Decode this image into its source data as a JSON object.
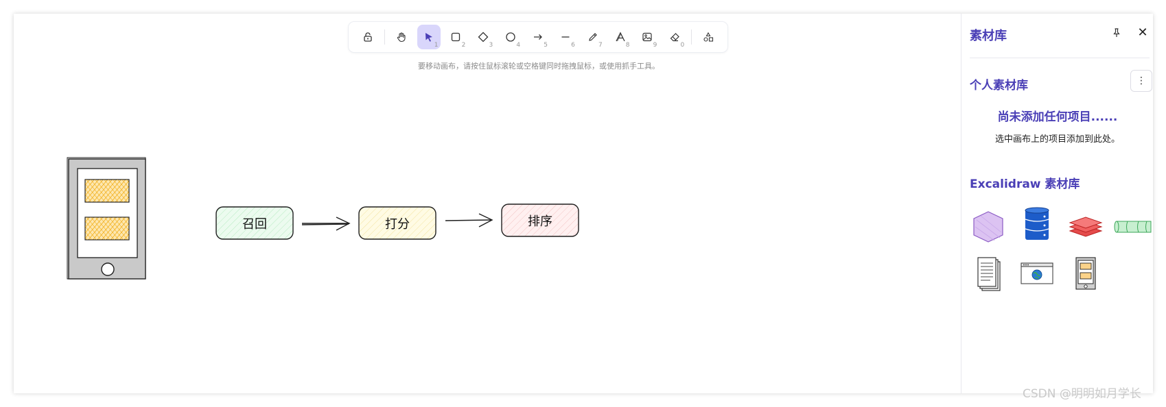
{
  "toolbar": {
    "tools": [
      {
        "name": "lock",
        "key": ""
      },
      {
        "name": "hand",
        "key": ""
      },
      {
        "name": "selection",
        "key": "1",
        "active": true
      },
      {
        "name": "rectangle",
        "key": "2"
      },
      {
        "name": "diamond",
        "key": "3"
      },
      {
        "name": "ellipse",
        "key": "4"
      },
      {
        "name": "arrow",
        "key": "5"
      },
      {
        "name": "line",
        "key": "6"
      },
      {
        "name": "draw",
        "key": "7"
      },
      {
        "name": "text",
        "key": "8"
      },
      {
        "name": "image",
        "key": "9"
      },
      {
        "name": "eraser",
        "key": "0"
      },
      {
        "name": "extra-tools",
        "key": ""
      }
    ],
    "accent_color": "#4a3fb6"
  },
  "hint": "要移动画布，请按住鼠标滚轮或空格键同时拖拽鼠标，或使用抓手工具。",
  "canvas": {
    "nodes": [
      {
        "label": "召回",
        "fill": "#d8f5dd"
      },
      {
        "label": "打分",
        "fill": "#fbf3c4"
      },
      {
        "label": "排序",
        "fill": "#fbe0e0"
      }
    ]
  },
  "sidebar": {
    "title": "素材库",
    "personal_title": "个人素材库",
    "empty_title": "尚未添加任何项目......",
    "empty_desc": "选中画布上的项目添加到此处。",
    "excalidraw_title": "Excalidraw 素材库",
    "items": [
      "hexagon",
      "database",
      "layers",
      "pipe",
      "document-stack",
      "browser-window",
      "mobile-phone"
    ]
  },
  "watermark": "CSDN @明明如月学长"
}
